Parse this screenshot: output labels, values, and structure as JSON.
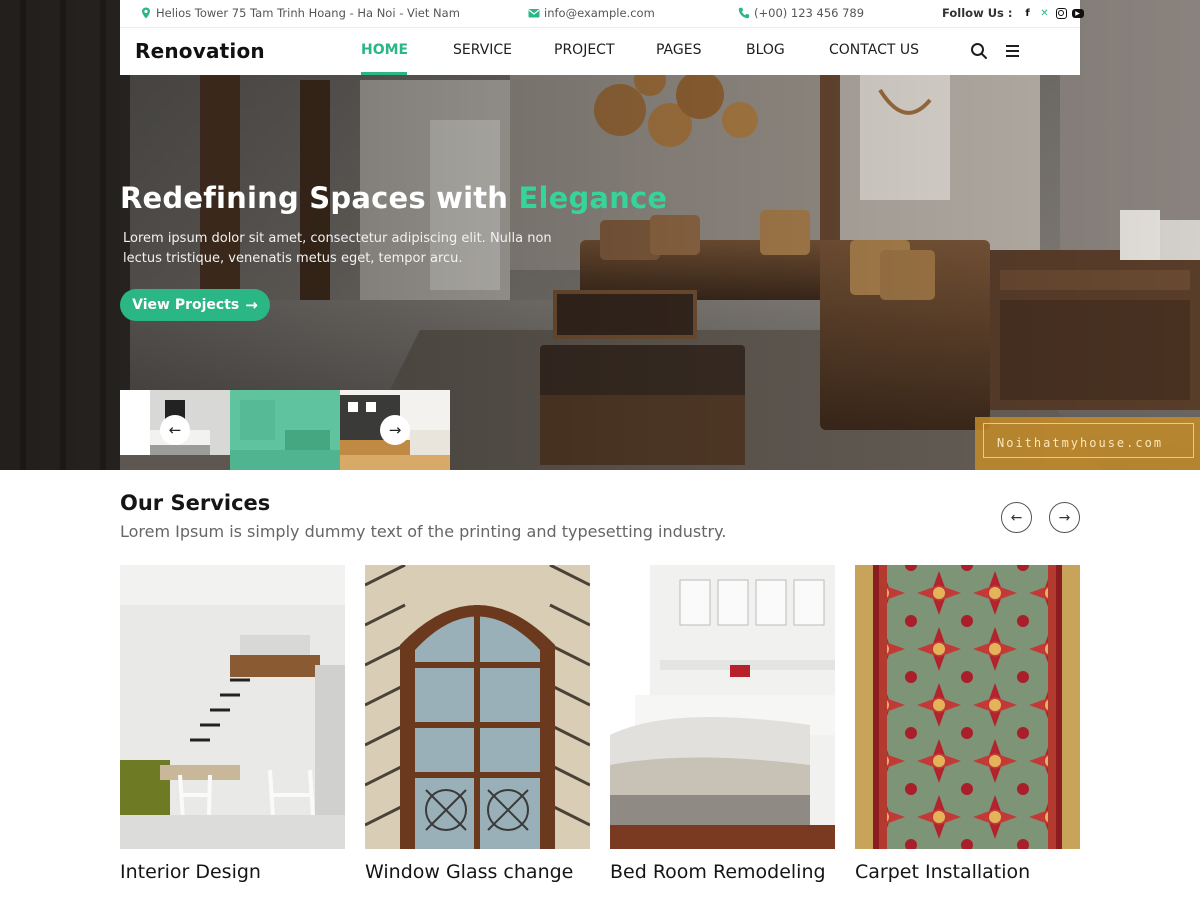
{
  "topbar": {
    "address": "Helios Tower 75 Tam Trinh Hoang - Ha Noi - Viet Nam",
    "email": "info@example.com",
    "phone": "(+00) 123 456 789",
    "follow_label": "Follow Us :",
    "social_icons": [
      "facebook-icon",
      "x-icon",
      "instagram-icon",
      "youtube-icon"
    ]
  },
  "nav": {
    "brand": "Renovation",
    "items": [
      "HOME",
      "SERVICE",
      "PROJECT",
      "PAGES",
      "BLOG",
      "CONTACT US"
    ],
    "active_item": "HOME",
    "icons": [
      "search-icon",
      "menu-icon"
    ]
  },
  "hero": {
    "title_main": "Redefining Spaces with",
    "title_accent": "Elegance",
    "text": "Lorem ipsum dolor sit amet, consectetur adipiscing elit. Nulla non lectus tristique, venenatis metus eget, tempor arcu.",
    "button_label": "View Projects",
    "button_arrow": "→",
    "prev_arrow": "←",
    "next_arrow": "→",
    "watermark": "Noithatmyhouse.com"
  },
  "services": {
    "title": "Our Services",
    "subtitle": "Lorem Ipsum is simply dummy text of the printing and typesetting industry.",
    "prev_arrow": "←",
    "next_arrow": "→",
    "cards": [
      {
        "name": "Interior Design"
      },
      {
        "name": "Window Glass change"
      },
      {
        "name": "Bed Room Remodeling"
      },
      {
        "name": "Carpet Installation"
      }
    ]
  },
  "colors": {
    "accent": "#2bb686",
    "accent_light": "#36d39b",
    "text_dark": "#151515",
    "text_muted": "#666666"
  }
}
